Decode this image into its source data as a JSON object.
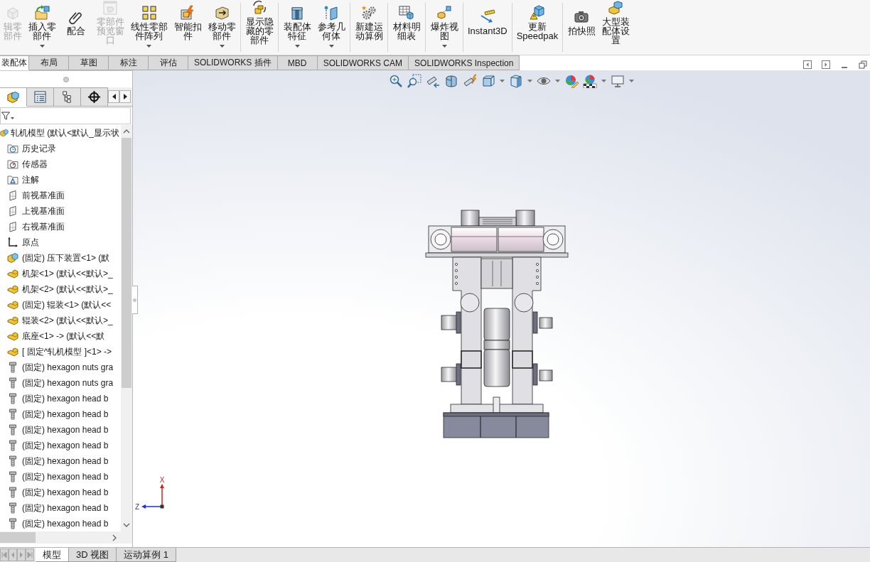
{
  "toolbar": {
    "groups": [
      {
        "buttons": [
          {
            "label": "辑零部件",
            "disabled": true,
            "dropdown": false
          },
          {
            "label": "插入零部件",
            "disabled": false,
            "dropdown": true
          },
          {
            "label": "配合",
            "disabled": false,
            "dropdown": false
          },
          {
            "label": "零部件预览窗口",
            "disabled": true,
            "dropdown": false
          },
          {
            "label": "线性零部件阵列",
            "disabled": false,
            "dropdown": true
          },
          {
            "label": "智能扣件",
            "disabled": false,
            "dropdown": false
          },
          {
            "label": "移动零部件",
            "disabled": false,
            "dropdown": true
          }
        ]
      },
      {
        "buttons": [
          {
            "label": "显示隐藏的零部件",
            "disabled": false,
            "dropdown": false
          }
        ]
      },
      {
        "buttons": [
          {
            "label": "装配体特征",
            "disabled": false,
            "dropdown": true
          },
          {
            "label": "参考几何体",
            "disabled": false,
            "dropdown": true
          }
        ]
      },
      {
        "buttons": [
          {
            "label": "新建运动算例",
            "disabled": false,
            "dropdown": false
          }
        ]
      },
      {
        "buttons": [
          {
            "label": "材料明细表",
            "disabled": false,
            "dropdown": false
          }
        ]
      },
      {
        "buttons": [
          {
            "label": "爆炸视图",
            "disabled": false,
            "dropdown": true
          }
        ]
      },
      {
        "buttons": [
          {
            "label": "Instant3D",
            "disabled": false,
            "dropdown": false
          }
        ]
      },
      {
        "buttons": [
          {
            "label": "更新Speedpak",
            "disabled": false,
            "dropdown": false
          }
        ]
      },
      {
        "buttons": [
          {
            "label": "拍快照",
            "disabled": false,
            "dropdown": false
          },
          {
            "label": "大型装配体设置",
            "disabled": false,
            "dropdown": false
          }
        ]
      }
    ]
  },
  "tabs": [
    {
      "label": "装配体",
      "selected": true
    },
    {
      "label": "布局",
      "selected": false
    },
    {
      "label": "草图",
      "selected": false
    },
    {
      "label": "标注",
      "selected": false
    },
    {
      "label": "评估",
      "selected": false
    },
    {
      "label": "SOLIDWORKS 插件",
      "selected": false
    },
    {
      "label": "MBD",
      "selected": false
    },
    {
      "label": "SOLIDWORKS CAM",
      "selected": false
    },
    {
      "label": "SOLIDWORKS Inspection",
      "selected": false
    }
  ],
  "feature_manager": {
    "tabs": [
      {
        "selected": true
      },
      {
        "selected": false
      },
      {
        "selected": false
      },
      {
        "selected": false
      }
    ],
    "tree": {
      "label": "轧机模型 (默认<默认_显示状",
      "kind": "assembly",
      "children": [
        {
          "label": "历史记录",
          "kind": "history"
        },
        {
          "label": "传感器",
          "kind": "sensors"
        },
        {
          "label": "注解",
          "kind": "annotations"
        },
        {
          "label": "前视基准面",
          "kind": "plane"
        },
        {
          "label": "上视基准面",
          "kind": "plane"
        },
        {
          "label": "右视基准面",
          "kind": "plane"
        },
        {
          "label": "原点",
          "kind": "origin"
        },
        {
          "label": "(固定) 压下装置<1> (默",
          "kind": "assembly"
        },
        {
          "label": "机架<1> (默认<<默认>_",
          "kind": "part"
        },
        {
          "label": "机架<2> (默认<<默认>_",
          "kind": "part"
        },
        {
          "label": "(固定) 辊装<1> (默认<<",
          "kind": "part"
        },
        {
          "label": "辊装<2> (默认<<默认>_",
          "kind": "part"
        },
        {
          "label": "底座<1> -> (默认<<默",
          "kind": "part"
        },
        {
          "label": "[ 固定^轧机模型 ]<1> ->",
          "kind": "part"
        },
        {
          "label": "(固定) hexagon nuts gra",
          "kind": "fastener"
        },
        {
          "label": "(固定) hexagon nuts gra",
          "kind": "fastener"
        },
        {
          "label": "(固定) hexagon head b",
          "kind": "fastener"
        },
        {
          "label": "(固定) hexagon head b",
          "kind": "fastener"
        },
        {
          "label": "(固定) hexagon head b",
          "kind": "fastener"
        },
        {
          "label": "(固定) hexagon head b",
          "kind": "fastener"
        },
        {
          "label": "(固定) hexagon head b",
          "kind": "fastener"
        },
        {
          "label": "(固定) hexagon head b",
          "kind": "fastener"
        },
        {
          "label": "(固定) hexagon head b",
          "kind": "fastener"
        },
        {
          "label": "(固定) hexagon head b",
          "kind": "fastener"
        },
        {
          "label": "(固定) hexagon head b",
          "kind": "fastener"
        }
      ]
    }
  },
  "triad": {
    "vertical_axis": "X",
    "horizontal_axis": "Z"
  },
  "bottom_tabs": [
    {
      "label": "模型",
      "selected": true
    },
    {
      "label": "3D 视图",
      "selected": false
    },
    {
      "label": "运动算例 1",
      "selected": false
    }
  ]
}
